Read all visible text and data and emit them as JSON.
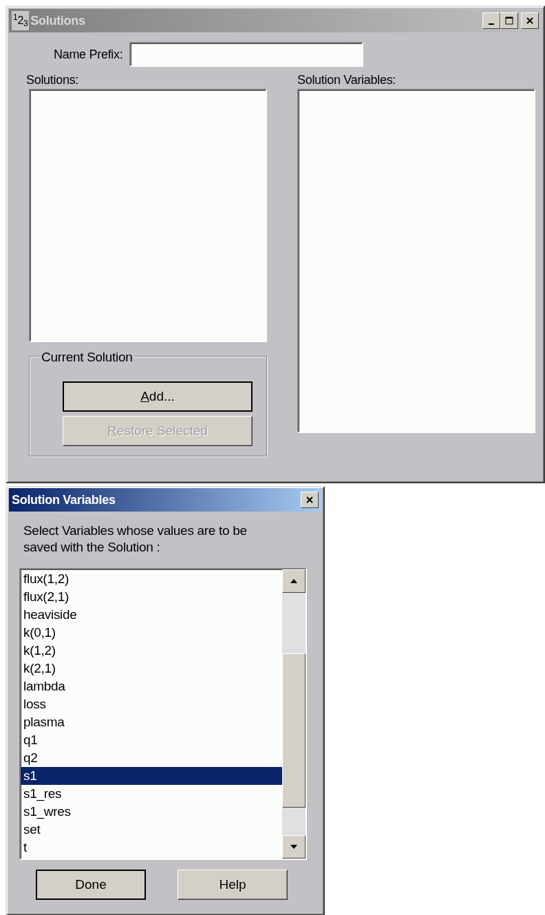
{
  "window": {
    "icon": "$^{1}$2$_{3}$",
    "title": "Solutions",
    "active": false
  },
  "name_prefix": {
    "label": "Name Prefix:"
  },
  "solutions": {
    "label": "Solutions:"
  },
  "solution_variables": {
    "label": "Solution Variables:"
  },
  "current_solution": {
    "label": "Current Solution",
    "buttons": [
      {
        "label": "Add...",
        "mnemonic": true,
        "default": true,
        "disabled": false
      },
      {
        "label": "Restore Selected",
        "mnemonic": true,
        "default": false,
        "disabled": true
      }
    ]
  },
  "dialog": {
    "title": "Solution Variables",
    "active": true,
    "prompt": "Select Variables whose values are to be saved with the Solution :",
    "items": [
      {
        "label": "flux(1,2)",
        "selected": false
      },
      {
        "label": "flux(2,1)",
        "selected": false
      },
      {
        "label": "heaviside",
        "selected": false
      },
      {
        "label": "k(0,1)",
        "selected": false
      },
      {
        "label": "k(1,2)",
        "selected": false
      },
      {
        "label": "k(2,1)",
        "selected": false
      },
      {
        "label": "lambda",
        "selected": false
      },
      {
        "label": "loss",
        "selected": false
      },
      {
        "label": "plasma",
        "selected": false
      },
      {
        "label": "q1",
        "selected": false
      },
      {
        "label": "q2",
        "selected": false
      },
      {
        "label": "s1",
        "selected": true
      },
      {
        "label": "s1_res",
        "selected": false
      },
      {
        "label": "s1_wres",
        "selected": false
      },
      {
        "label": "set",
        "selected": false
      },
      {
        "label": "t",
        "selected": false
      }
    ],
    "buttons": [
      {
        "label": "Done",
        "default": true
      },
      {
        "label": "Help",
        "default": false
      }
    ]
  }
}
